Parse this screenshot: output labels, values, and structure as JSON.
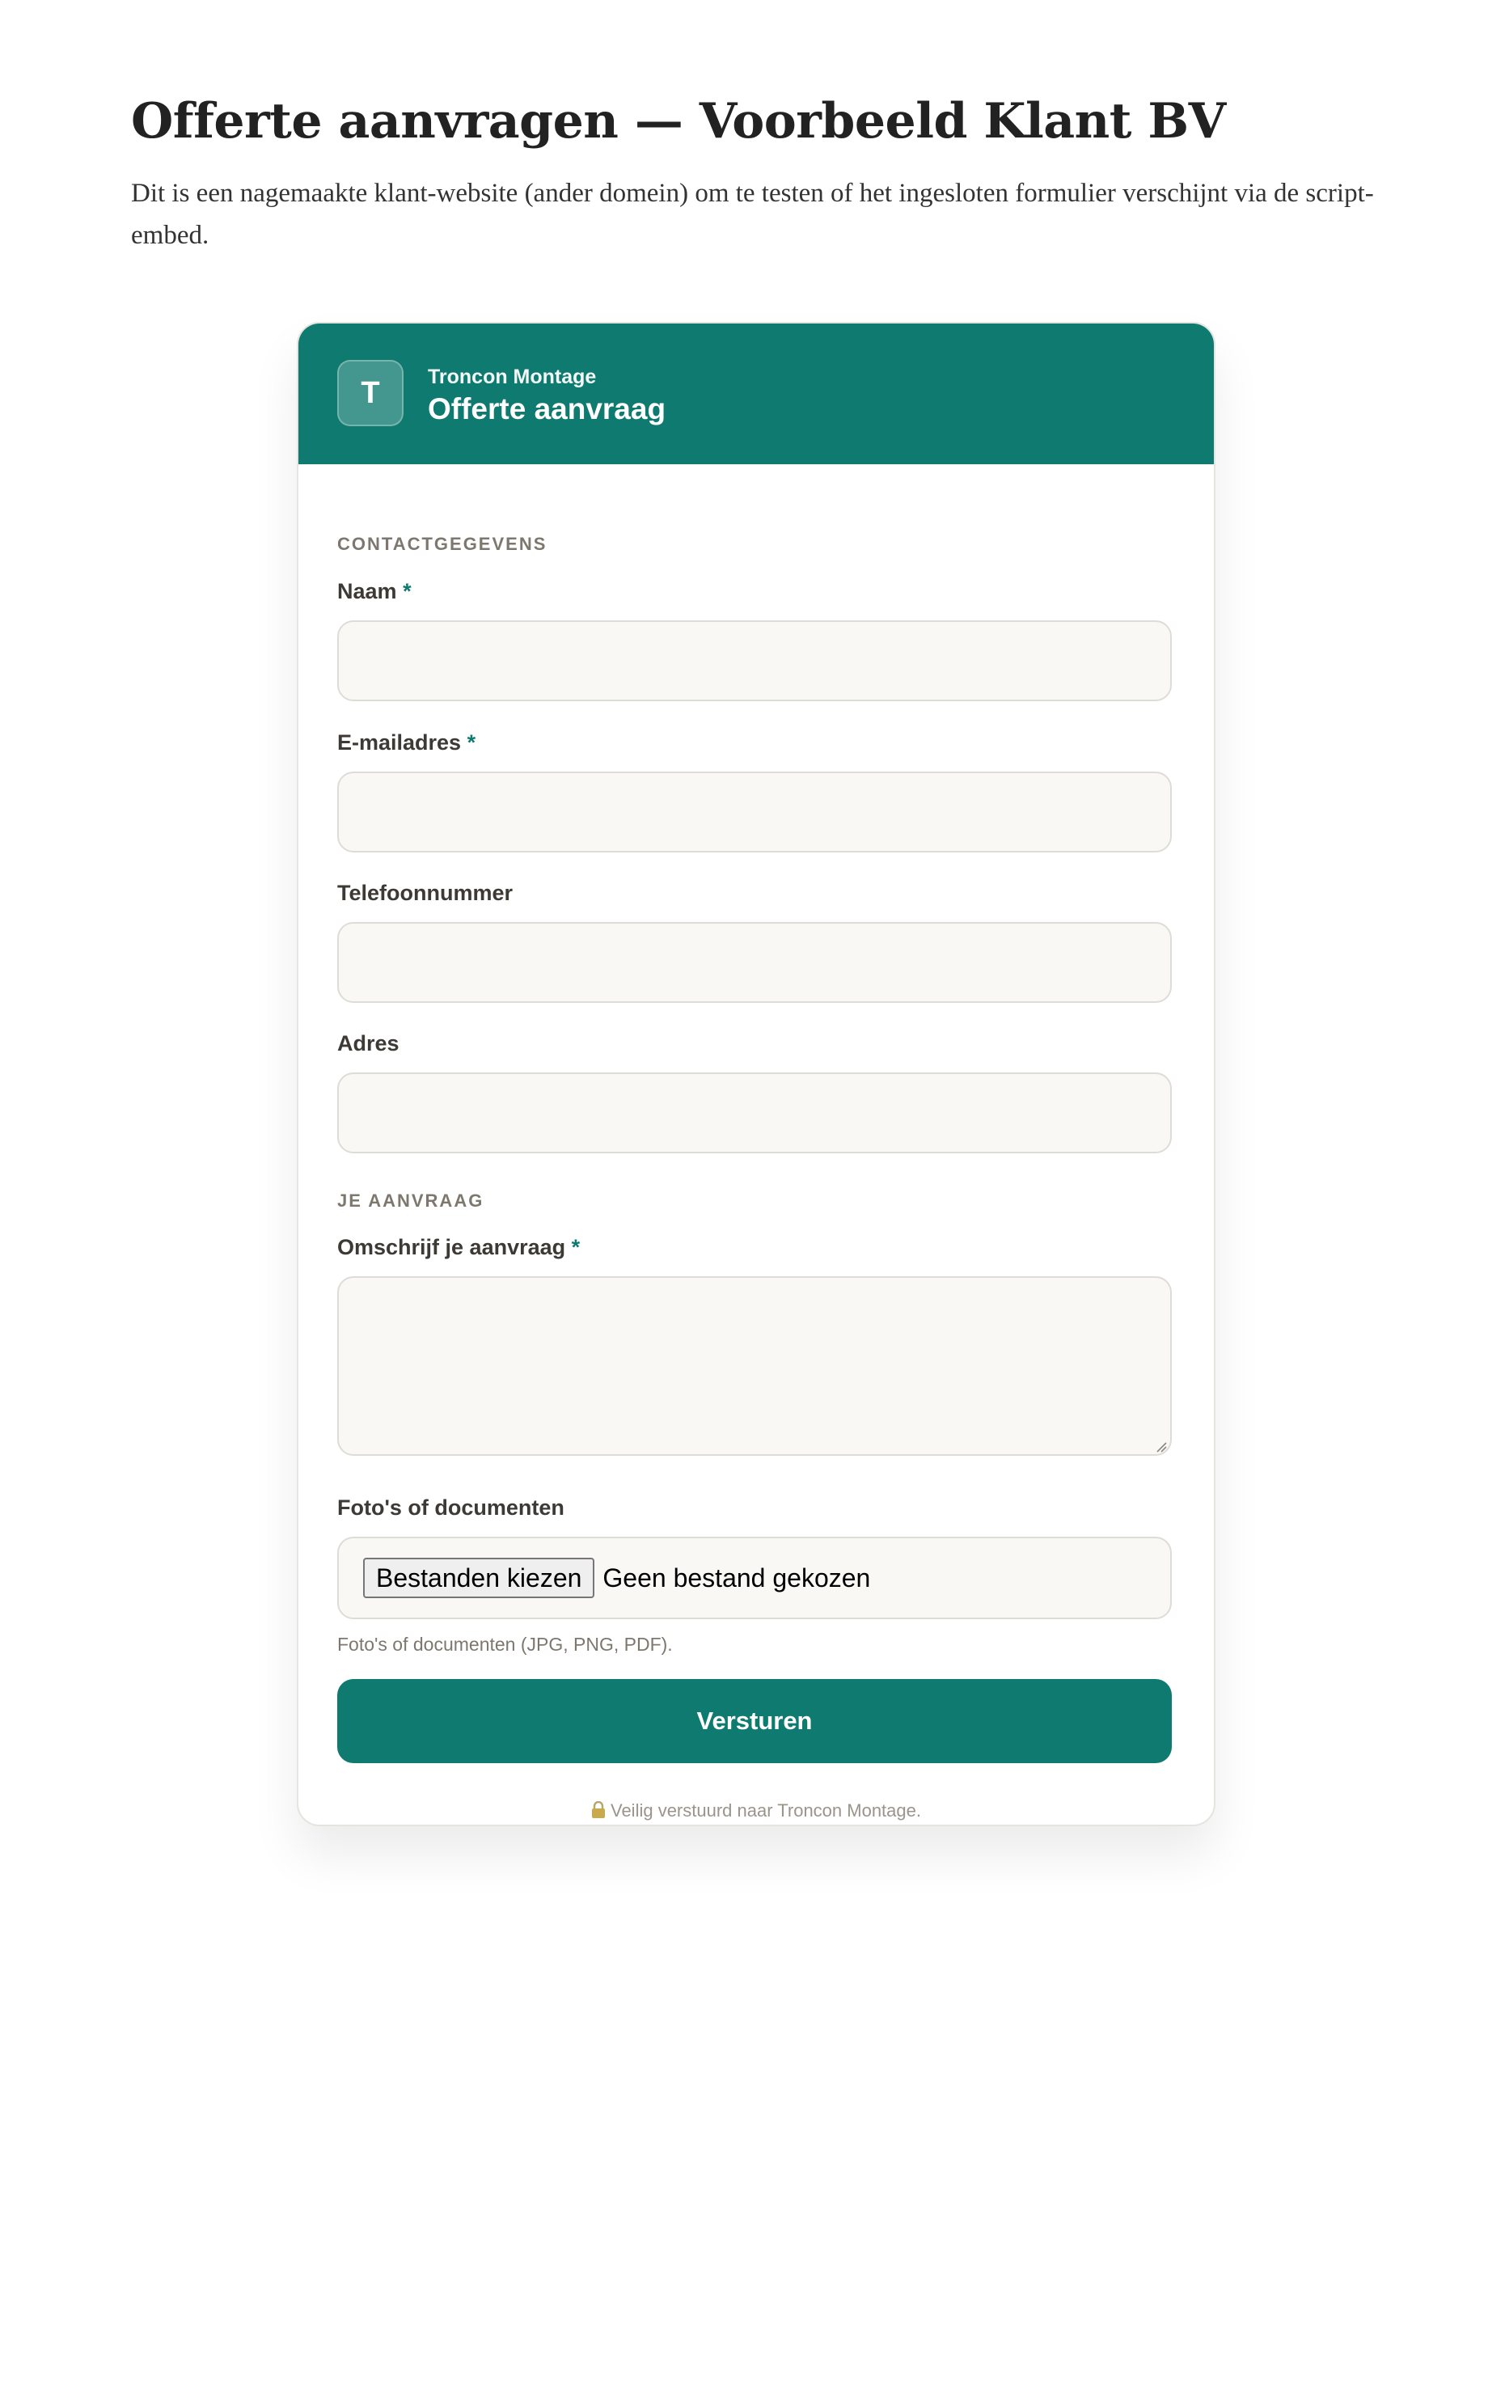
{
  "page": {
    "title": "Offerte aanvragen — Voorbeeld Klant BV",
    "intro": "Dit is een nagemaakte klant-website (ander domein) om te testen of het ingesloten formulier verschijnt via de script-embed."
  },
  "widget": {
    "logo_letter": "T",
    "company": "Troncon Montage",
    "title": "Offerte aanvraag",
    "sections": {
      "contact": "CONTACTGEGEVENS",
      "request": "JE AANVRAAG"
    },
    "fields": {
      "name": {
        "label": "Naam",
        "value": ""
      },
      "email": {
        "label": "E-mailadres",
        "value": ""
      },
      "phone": {
        "label": "Telefoonnummer",
        "value": ""
      },
      "address": {
        "label": "Adres",
        "value": ""
      },
      "description": {
        "label": "Omschrijf je aanvraag",
        "value": ""
      },
      "files": {
        "label": "Foto's of documenten",
        "button": "Bestanden kiezen",
        "status": "Geen bestand gekozen",
        "hint": "Foto's of documenten (JPG, PNG, PDF)."
      }
    },
    "required_mark": "*",
    "submit_label": "Versturen",
    "footer_note": "Veilig verstuurd naar Troncon Montage."
  },
  "colors": {
    "accent": "#0f7a6f",
    "field_bg": "#f9f8f5",
    "muted_text": "#7d786e"
  }
}
